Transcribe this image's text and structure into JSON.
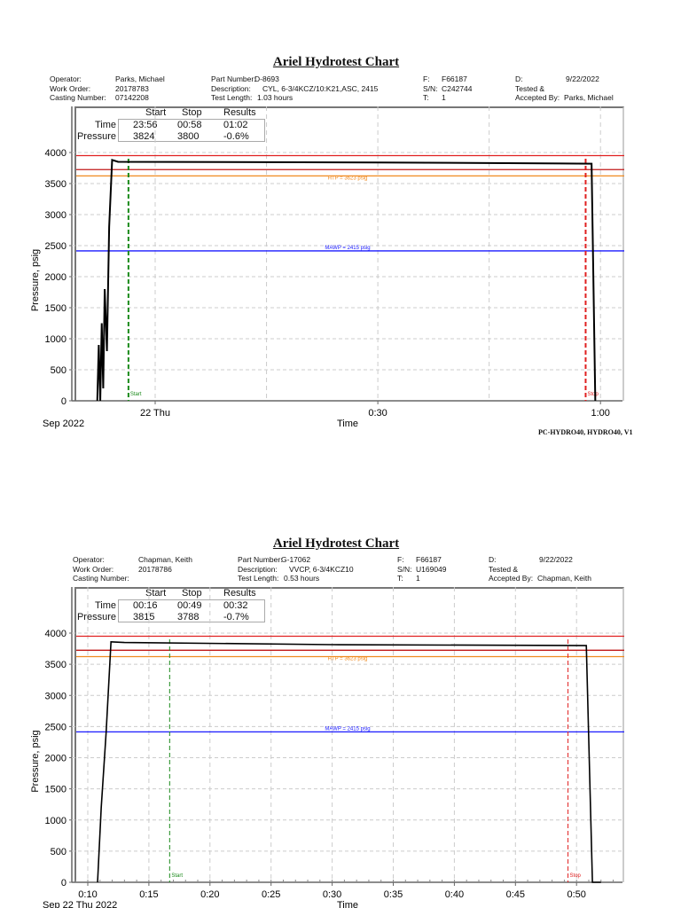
{
  "charts": [
    {
      "title": "Ariel Hydrotest Chart",
      "header": {
        "operator_label": "Operator:",
        "operator": "Parks, Michael",
        "work_order_label": "Work Order:",
        "work_order": "20178783",
        "casting_label": "Casting Number:",
        "casting": "07142208",
        "part_label": "Part Number:",
        "part": "D-8693",
        "desc_label": "Description:",
        "desc": "CYL, 6-3/4KCZ/10:K21,ASC, 2415",
        "length_label": "Test Length:",
        "length": "1.03 hours",
        "f_label": "F:",
        "f": "F66187",
        "sn_label": "S/N:",
        "sn": "C242744",
        "t_label": "T:",
        "t": "1",
        "d_label": "D:",
        "d": "9/22/2022",
        "tested_label": "Tested &",
        "accepted_label": "Accepted By:",
        "accepted": "Parks, Michael"
      },
      "results": {
        "col_start": "Start",
        "col_stop": "Stop",
        "col_results": "Results",
        "time_label": "Time",
        "time_start": "23:56",
        "time_stop": "00:58",
        "time_result": "01:02",
        "pressure_label": "Pressure",
        "pressure_start": "3824",
        "pressure_stop": "3800",
        "pressure_result": "-0.6%"
      },
      "chart_data": {
        "type": "line",
        "ylabel": "Pressure, psig",
        "xlabel": "Time",
        "date_label": "Sep 2022",
        "ylim": [
          0,
          4000
        ],
        "yticks": [
          0,
          500,
          1000,
          1500,
          2000,
          2500,
          3000,
          3500,
          4000
        ],
        "xlim_minutes": [
          -11.2,
          63
        ],
        "xticks": [
          {
            "m": 0,
            "label": "22 Thu"
          },
          {
            "m": 30,
            "label": "0:30"
          },
          {
            "m": 60,
            "label": "1:00"
          }
        ],
        "xgrid_minutes": [
          0,
          15,
          30,
          45,
          60
        ],
        "minor_tick_step": null,
        "reference_lines": [
          {
            "value": 3950,
            "color": "#e02020",
            "label": ""
          },
          {
            "value": 3725,
            "color": "#c01818",
            "label": ""
          },
          {
            "value": 3623,
            "color": "#f08a20",
            "label": "HTP = 3623 psig"
          },
          {
            "value": 2415,
            "color": "#1a1aff",
            "label": "MAWP = 2415 psig"
          }
        ],
        "start_marker": {
          "minute": -3.6,
          "label": "Start",
          "color": "#1a8a1a"
        },
        "stop_marker": {
          "minute": 58,
          "label": "Stop",
          "color": "#e02020"
        },
        "series": [
          {
            "name": "Pressure",
            "points": [
              [
                -7.8,
                0
              ],
              [
                -7.6,
                900
              ],
              [
                -7.4,
                0
              ],
              [
                -7.2,
                1250
              ],
              [
                -7,
                200
              ],
              [
                -6.8,
                1800
              ],
              [
                -6.5,
                800
              ],
              [
                -6.2,
                2800
              ],
              [
                -5.8,
                3880
              ],
              [
                -5,
                3850
              ],
              [
                30,
                3840
              ],
              [
                58.8,
                3820
              ],
              [
                59.3,
                0
              ]
            ]
          }
        ]
      },
      "footer": "PC-HYDRO40, HYDRO40, V1"
    },
    {
      "title": "Ariel Hydrotest Chart",
      "header": {
        "operator_label": "Operator:",
        "operator": "Chapman, Keith",
        "work_order_label": "Work Order:",
        "work_order": "20178786",
        "casting_label": "Casting Number:",
        "casting": "",
        "part_label": "Part Number:",
        "part": "G-17062",
        "desc_label": "Description:",
        "desc": "VVCP, 6-3/4KCZ10",
        "length_label": "Test Length:",
        "length": "0.53 hours",
        "f_label": "F:",
        "f": "F66187",
        "sn_label": "S/N:",
        "sn": "U169049",
        "t_label": "T:",
        "t": "1",
        "d_label": "D:",
        "d": "9/22/2022",
        "tested_label": "Tested &",
        "accepted_label": "Accepted By:",
        "accepted": "Chapman, Keith"
      },
      "results": {
        "col_start": "Start",
        "col_stop": "Stop",
        "col_results": "Results",
        "time_label": "Time",
        "time_start": "00:16",
        "time_stop": "00:49",
        "time_result": "00:32",
        "pressure_label": "Pressure",
        "pressure_start": "3815",
        "pressure_stop": "3788",
        "pressure_result": "-0.7%"
      },
      "chart_data": {
        "type": "line",
        "ylabel": "Pressure, psig",
        "xlabel": "Time",
        "date_label": "Sep 22 Thu 2022",
        "ylim": [
          0,
          4000
        ],
        "yticks": [
          0,
          500,
          1000,
          1500,
          2000,
          2500,
          3000,
          3500,
          4000
        ],
        "xlim_minutes": [
          8.7,
          53.8
        ],
        "xticks": [
          {
            "m": 10,
            "label": "0:10"
          },
          {
            "m": 15,
            "label": "0:15"
          },
          {
            "m": 20,
            "label": "0:20"
          },
          {
            "m": 25,
            "label": "0:25"
          },
          {
            "m": 30,
            "label": "0:30"
          },
          {
            "m": 35,
            "label": "0:35"
          },
          {
            "m": 40,
            "label": "0:40"
          },
          {
            "m": 45,
            "label": "0:45"
          },
          {
            "m": 50,
            "label": "0:50"
          }
        ],
        "xgrid_minutes": [
          10,
          15,
          20,
          25,
          30,
          35,
          40,
          45,
          50
        ],
        "minor_tick_step": 1,
        "reference_lines": [
          {
            "value": 3950,
            "color": "#e02020",
            "label": ""
          },
          {
            "value": 3725,
            "color": "#c01818",
            "label": ""
          },
          {
            "value": 3623,
            "color": "#f08a20",
            "label": "HTP = 3623 psig"
          },
          {
            "value": 2415,
            "color": "#1a1aff",
            "label": "MAWP = 2415 psig"
          }
        ],
        "start_marker": {
          "minute": 16.7,
          "label": "Start",
          "color": "#1a8a1a"
        },
        "stop_marker": {
          "minute": 49.3,
          "label": "Stop",
          "color": "#e02020"
        },
        "series": [
          {
            "name": "Pressure",
            "points": [
              [
                10.8,
                0
              ],
              [
                11.1,
                1200
              ],
              [
                11.5,
                2400
              ],
              [
                11.9,
                3860
              ],
              [
                13,
                3850
              ],
              [
                30,
                3815
              ],
              [
                50.8,
                3800
              ],
              [
                51.3,
                0
              ],
              [
                52,
                0
              ]
            ]
          }
        ]
      },
      "footer": ""
    }
  ]
}
